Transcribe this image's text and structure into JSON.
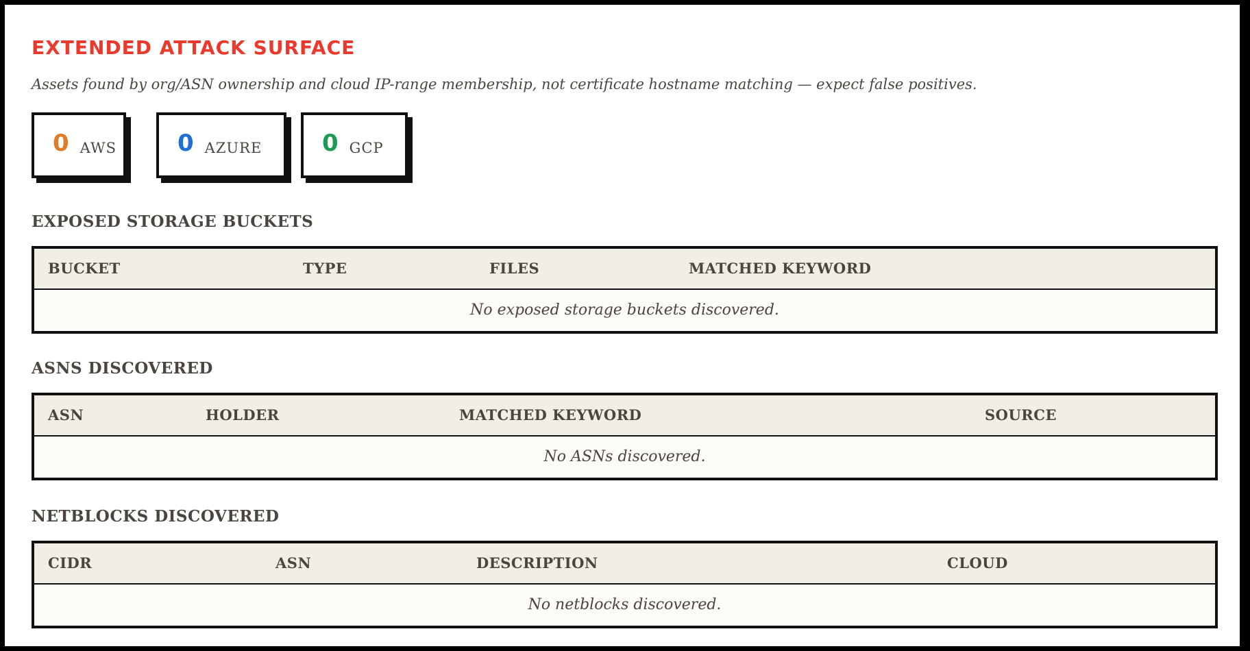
{
  "header": {
    "title": "EXTENDED ATTACK SURFACE",
    "subtitle": "Assets found by org/ASN ownership and cloud IP-range membership, not certificate hostname matching — expect false positives."
  },
  "stats": [
    {
      "value": "0",
      "label": "AWS",
      "color": "#e07b27"
    },
    {
      "value": "0",
      "label": "AZURE",
      "color": "#1f6fd6"
    },
    {
      "value": "0",
      "label": "GCP",
      "color": "#1f9a54"
    }
  ],
  "buckets": {
    "heading": "EXPOSED STORAGE BUCKETS",
    "columns": [
      "BUCKET",
      "TYPE",
      "FILES",
      "MATCHED KEYWORD"
    ],
    "empty_text": "No exposed storage buckets discovered."
  },
  "asns": {
    "heading": "ASNS DISCOVERED",
    "columns": [
      "ASN",
      "HOLDER",
      "MATCHED KEYWORD",
      "SOURCE"
    ],
    "empty_text": "No ASNs discovered."
  },
  "netblocks": {
    "heading": "NETBLOCKS DISCOVERED",
    "columns": [
      "CIDR",
      "ASN",
      "DESCRIPTION",
      "CLOUD"
    ],
    "empty_text": "No netblocks discovered."
  }
}
